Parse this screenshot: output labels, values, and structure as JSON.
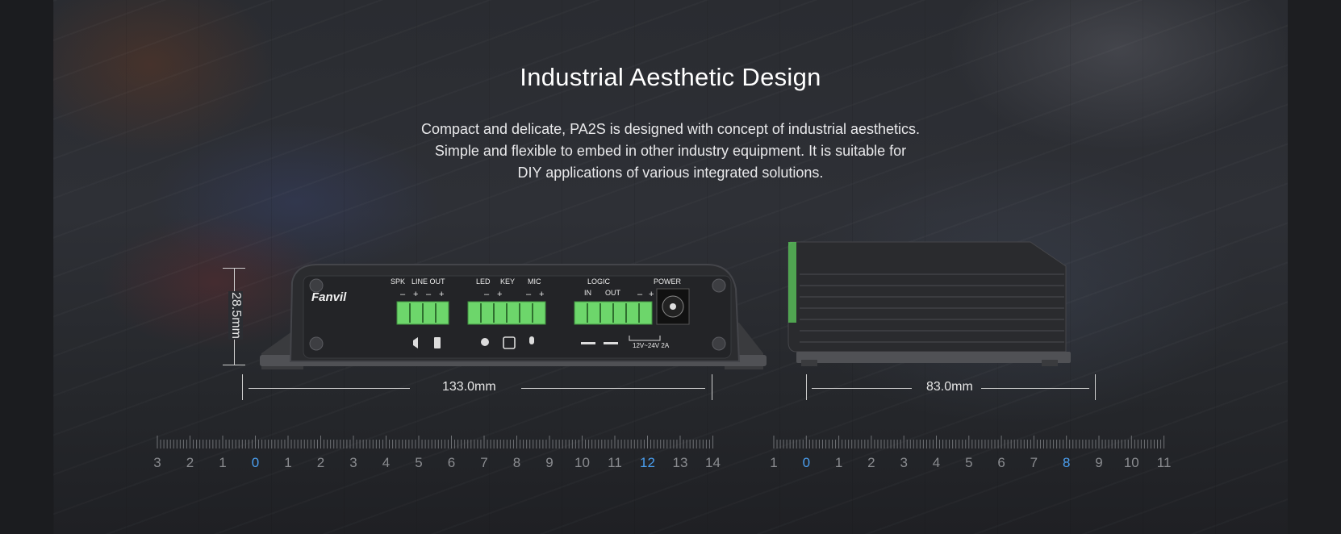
{
  "header": {
    "title": "Industrial Aesthetic Design",
    "description_lines": [
      "Compact and delicate, PA2S is designed with concept of industrial aesthetics.",
      "Simple and flexible to embed in other industry equipment. It is suitable for",
      "DIY applications of various integrated solutions."
    ]
  },
  "device_front": {
    "brand": "Fanvil",
    "port_labels": [
      "SPK",
      "LINE OUT",
      "LED",
      "KEY",
      "MIC",
      "LOGIC",
      "POWER"
    ],
    "logic_sub_labels": [
      "IN",
      "OUT"
    ],
    "power_rating": "12V~24V 2A",
    "height_dim": "28.5mm",
    "width_dim": "133.0mm"
  },
  "device_side": {
    "depth_dim": "83.0mm"
  },
  "rulers": {
    "left": {
      "labels": [
        "3",
        "2",
        "1",
        "0",
        "1",
        "2",
        "3",
        "4",
        "5",
        "6",
        "7",
        "8",
        "9",
        "10",
        "11",
        "12",
        "13",
        "14"
      ],
      "accent_indices": [
        3,
        15
      ]
    },
    "right": {
      "labels": [
        "1",
        "0",
        "1",
        "2",
        "3",
        "4",
        "5",
        "6",
        "7",
        "8",
        "9",
        "10",
        "11"
      ],
      "accent_indices": [
        1,
        9
      ]
    }
  },
  "colors": {
    "accent": "#4a9ff0",
    "terminal_green": "#6dd66b",
    "device_body": "#2b2c2f"
  }
}
